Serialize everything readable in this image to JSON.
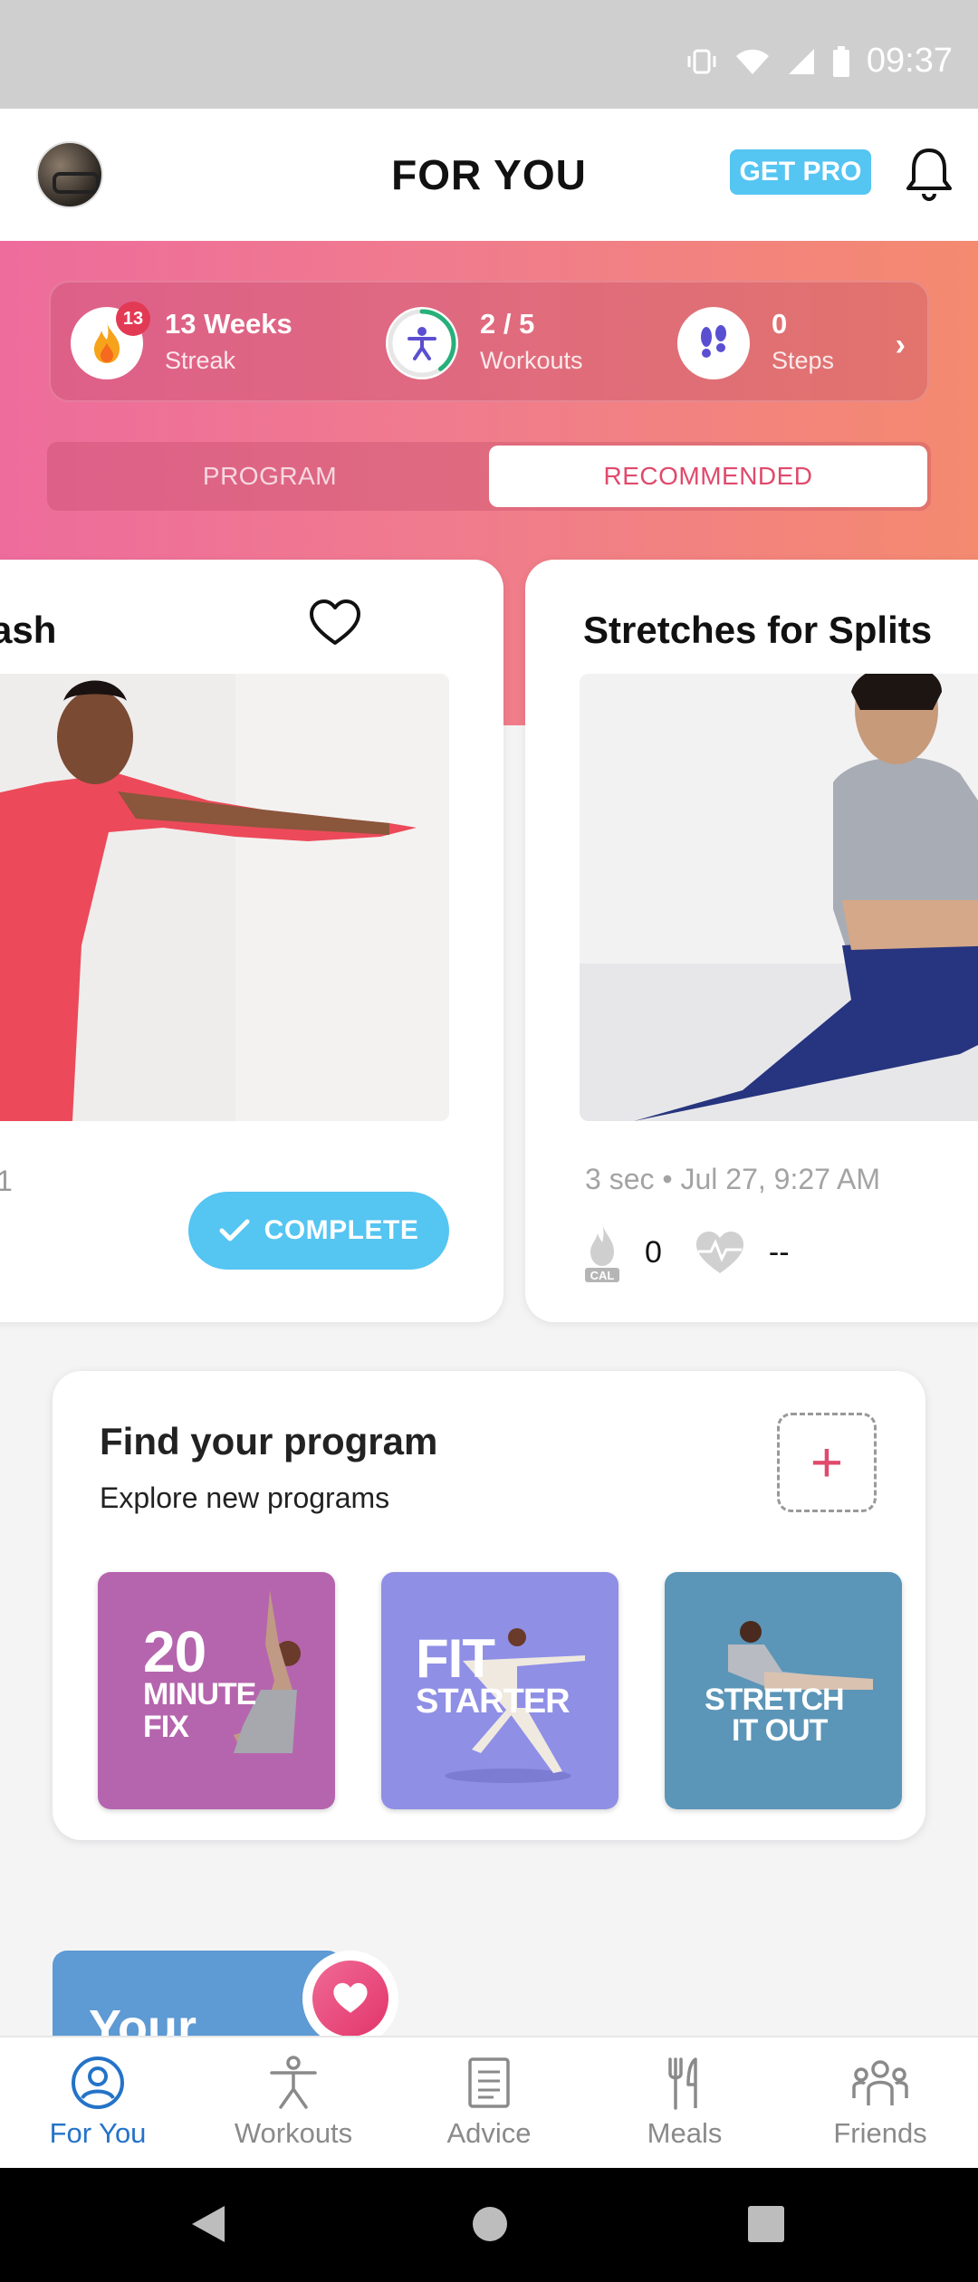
{
  "status_bar": {
    "time": "09:37"
  },
  "header": {
    "title": "FOR YOU",
    "get_pro_label": "GET PRO"
  },
  "stats": {
    "streak": {
      "value": "13 Weeks",
      "label": "Streak",
      "badge": "13"
    },
    "workouts": {
      "value": "2 / 5",
      "label": "Workouts",
      "progress": 0.4
    },
    "steps": {
      "value": "0",
      "label": "Steps"
    }
  },
  "tabs": {
    "program": "PROGRAM",
    "recommended": "RECOMMENDED",
    "selected": "RECOMMENDED"
  },
  "cards": [
    {
      "title_fragment": "ash",
      "meta_fragment": "1",
      "button": "COMPLETE"
    },
    {
      "title": "Stretches for Splits",
      "meta": "3 sec • Jul 27, 9:27 AM",
      "calories": "0",
      "cal_label": "CAL",
      "heart_rate": "--"
    }
  ],
  "find_program": {
    "title": "Find your program",
    "subtitle": "Explore new programs",
    "add_symbol": "+",
    "tiles": [
      {
        "line1": "20",
        "line2": "MINUTE",
        "line3": "FIX",
        "color": "#b565ad"
      },
      {
        "line1": "FIT",
        "line2": "STARTER",
        "color": "#8f8fe6"
      },
      {
        "line1": "STRETCH",
        "line2": "IT OUT",
        "color": "#5b95b7"
      }
    ]
  },
  "promo": {
    "text": "Your"
  },
  "bottom_nav": [
    {
      "label": "For You",
      "icon": "person-circle-icon",
      "active": true
    },
    {
      "label": "Workouts",
      "icon": "figure-icon",
      "active": false
    },
    {
      "label": "Advice",
      "icon": "document-icon",
      "active": false
    },
    {
      "label": "Meals",
      "icon": "fork-knife-icon",
      "active": false
    },
    {
      "label": "Friends",
      "icon": "people-icon",
      "active": false
    }
  ],
  "colors": {
    "accent_blue": "#55c5f2",
    "brand_pink": "#e04a6c",
    "nav_active": "#2473c8"
  }
}
